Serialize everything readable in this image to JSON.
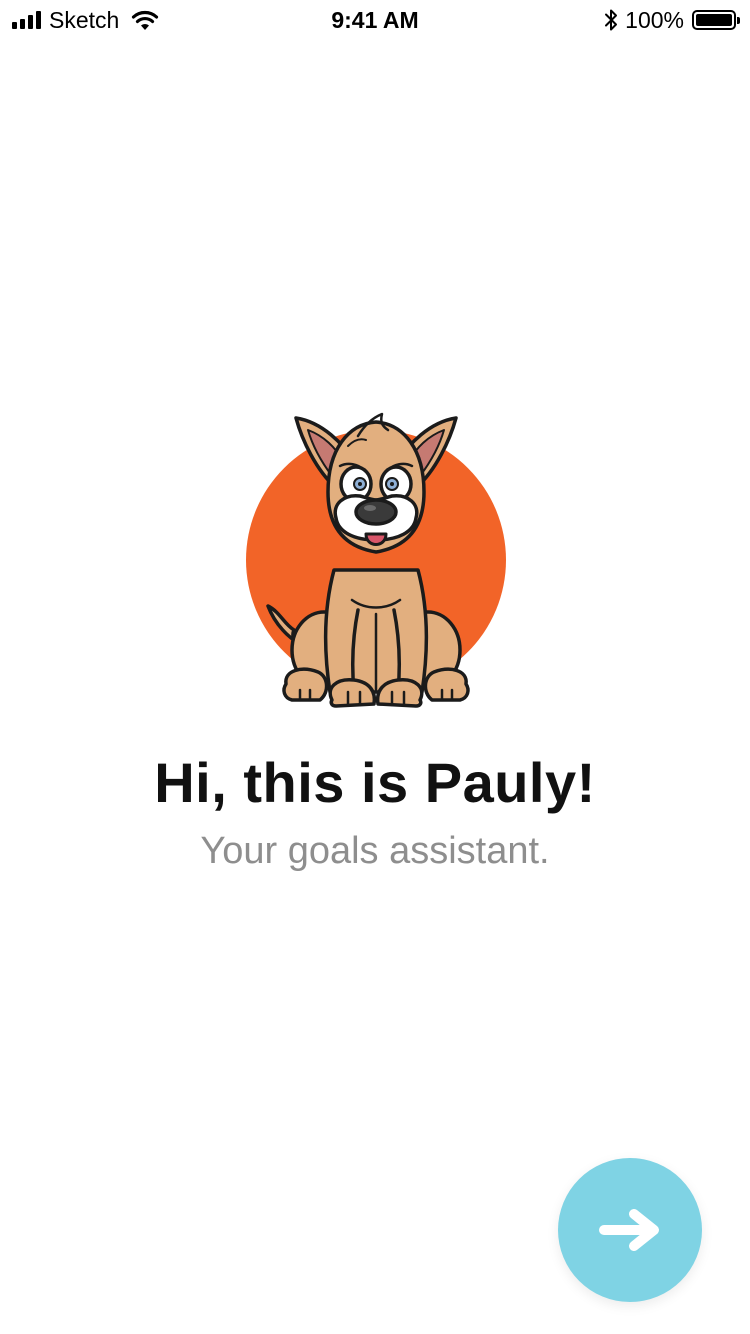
{
  "status_bar": {
    "carrier": "Sketch",
    "time": "9:41 AM",
    "battery_percent": "100%",
    "battery_level": 1.0,
    "signal_icon": "cellular-signal-icon",
    "wifi_icon": "wifi-icon",
    "bluetooth_icon": "bluetooth-icon",
    "battery_icon": "battery-icon"
  },
  "onboarding": {
    "mascot_icon": "dog-mascot-illustration",
    "title": "Hi, this is Pauly!",
    "subtitle": "Your goals assistant."
  },
  "next_button": {
    "icon": "arrow-right-icon"
  },
  "colors": {
    "mascot_background": "#F26428",
    "next_button": "#7FD3E4",
    "next_arrow": "#FFFFFF",
    "title": "#111111",
    "subtitle": "#8E8E8E"
  }
}
